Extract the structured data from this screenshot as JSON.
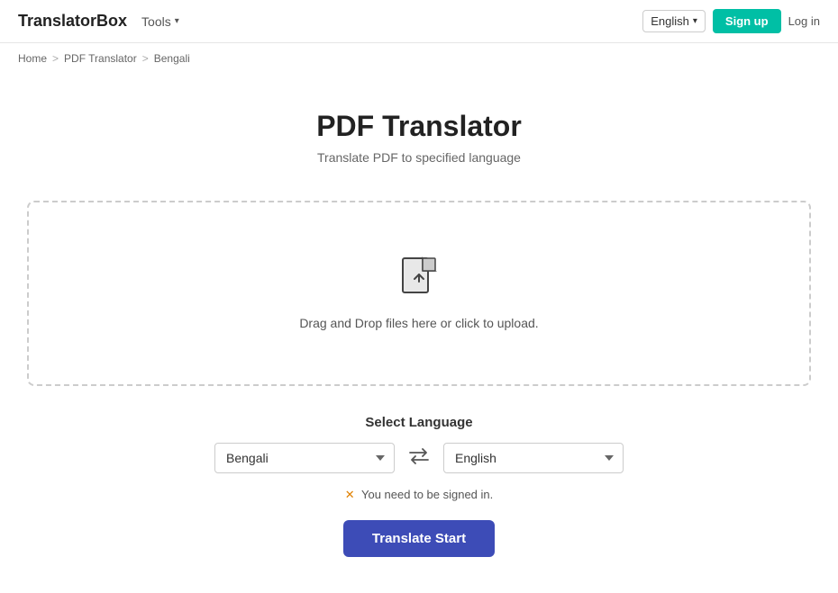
{
  "header": {
    "logo": "TranslatorBox",
    "tools_label": "Tools",
    "lang_selector": "English",
    "signup_label": "Sign up",
    "login_label": "Log in"
  },
  "breadcrumb": {
    "home": "Home",
    "pdf_translator": "PDF Translator",
    "current": "Bengali",
    "sep": ">"
  },
  "main": {
    "title": "PDF Translator",
    "subtitle": "Translate PDF to specified language",
    "upload": {
      "drag_text": "Drag and Drop files here or click to upload."
    },
    "lang_section": {
      "title": "Select Language",
      "source_lang": "Bengali",
      "target_lang": "English"
    },
    "warning": "✕ You need to be signed in.",
    "translate_button": "Translate Start"
  }
}
